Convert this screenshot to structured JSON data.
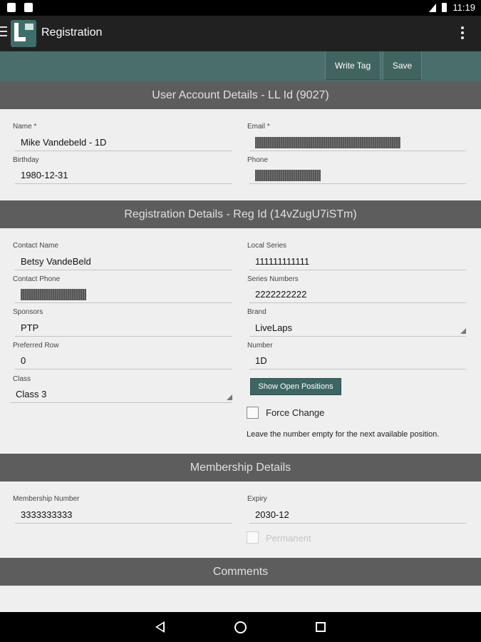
{
  "status_bar": {
    "time": "11:19"
  },
  "app_bar": {
    "title": "Registration"
  },
  "actions": {
    "write_tag": "Write Tag",
    "save": "Save"
  },
  "user_account": {
    "header": "User Account Details - LL Id (9027)",
    "name_label": "Name *",
    "name_value": "Mike  Vandebeld - 1D",
    "email_label": "Email *",
    "birthday_label": "Birthday",
    "birthday_value": "1980-12-31",
    "phone_label": "Phone"
  },
  "registration": {
    "header": "Registration Details - Reg Id (14vZugU7iSTm)",
    "contact_name_label": "Contact Name",
    "contact_name_value": "Betsy VandeBeld",
    "local_series_label": "Local Series",
    "local_series_value": "111111111111",
    "contact_phone_label": "Contact Phone",
    "series_numbers_label": "Series Numbers",
    "series_numbers_value": "2222222222",
    "sponsors_label": "Sponsors",
    "sponsors_value": "PTP",
    "brand_label": "Brand",
    "brand_value": "LiveLaps",
    "preferred_row_label": "Preferred Row",
    "preferred_row_value": "0",
    "number_label": "Number",
    "number_value": "1D",
    "class_label": "Class",
    "class_value": "Class 3",
    "show_open_positions": "Show Open Positions",
    "force_change_label": "Force Change",
    "note": "Leave the number empty for the next available position."
  },
  "membership": {
    "header": "Membership Details",
    "number_label": "Membership Number",
    "number_value": "3333333333",
    "expiry_label": "Expiry",
    "expiry_value": "2030-12",
    "permanent_label": "Permanent"
  },
  "comments": {
    "header": "Comments"
  }
}
